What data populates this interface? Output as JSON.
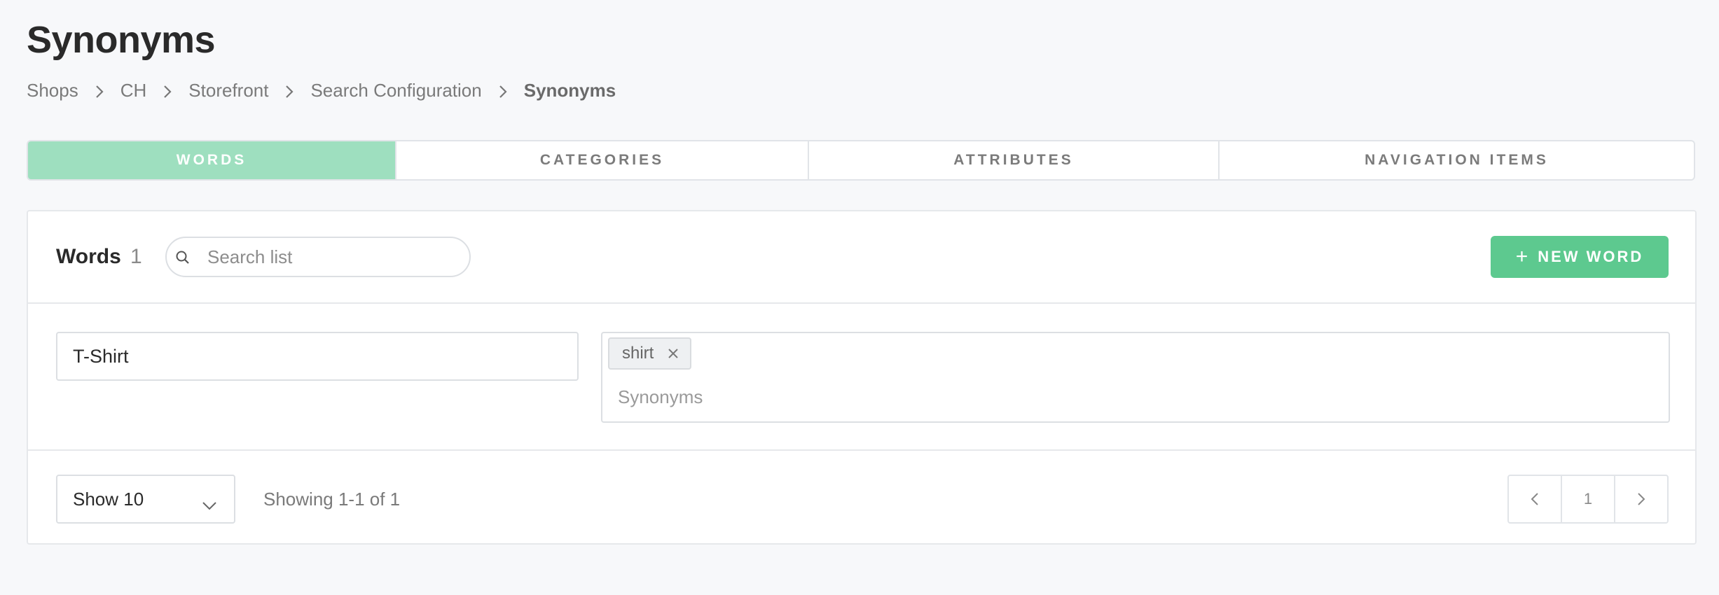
{
  "page": {
    "title": "Synonyms"
  },
  "breadcrumb": [
    "Shops",
    "CH",
    "Storefront",
    "Search Configuration",
    "Synonyms"
  ],
  "tabs": [
    {
      "label": "WORDS",
      "active": true
    },
    {
      "label": "CATEGORIES",
      "active": false
    },
    {
      "label": "ATTRIBUTES",
      "active": false
    },
    {
      "label": "NAVIGATION ITEMS",
      "active": false
    }
  ],
  "list": {
    "title": "Words",
    "count": "1",
    "search_placeholder": "Search list",
    "new_button_label": "NEW WORD",
    "new_button_icon": "plus-icon"
  },
  "rows": [
    {
      "word": "T-Shirt",
      "synonym_tags": [
        "shirt"
      ],
      "synonyms_placeholder": "Synonyms"
    }
  ],
  "footer": {
    "page_size": "Show 10",
    "showing": "Showing 1-1 of 1",
    "current_page": "1"
  },
  "colors": {
    "active_tab": "#9edfbf",
    "primary_button": "#5dc98f",
    "background": "#f7f8fa"
  }
}
